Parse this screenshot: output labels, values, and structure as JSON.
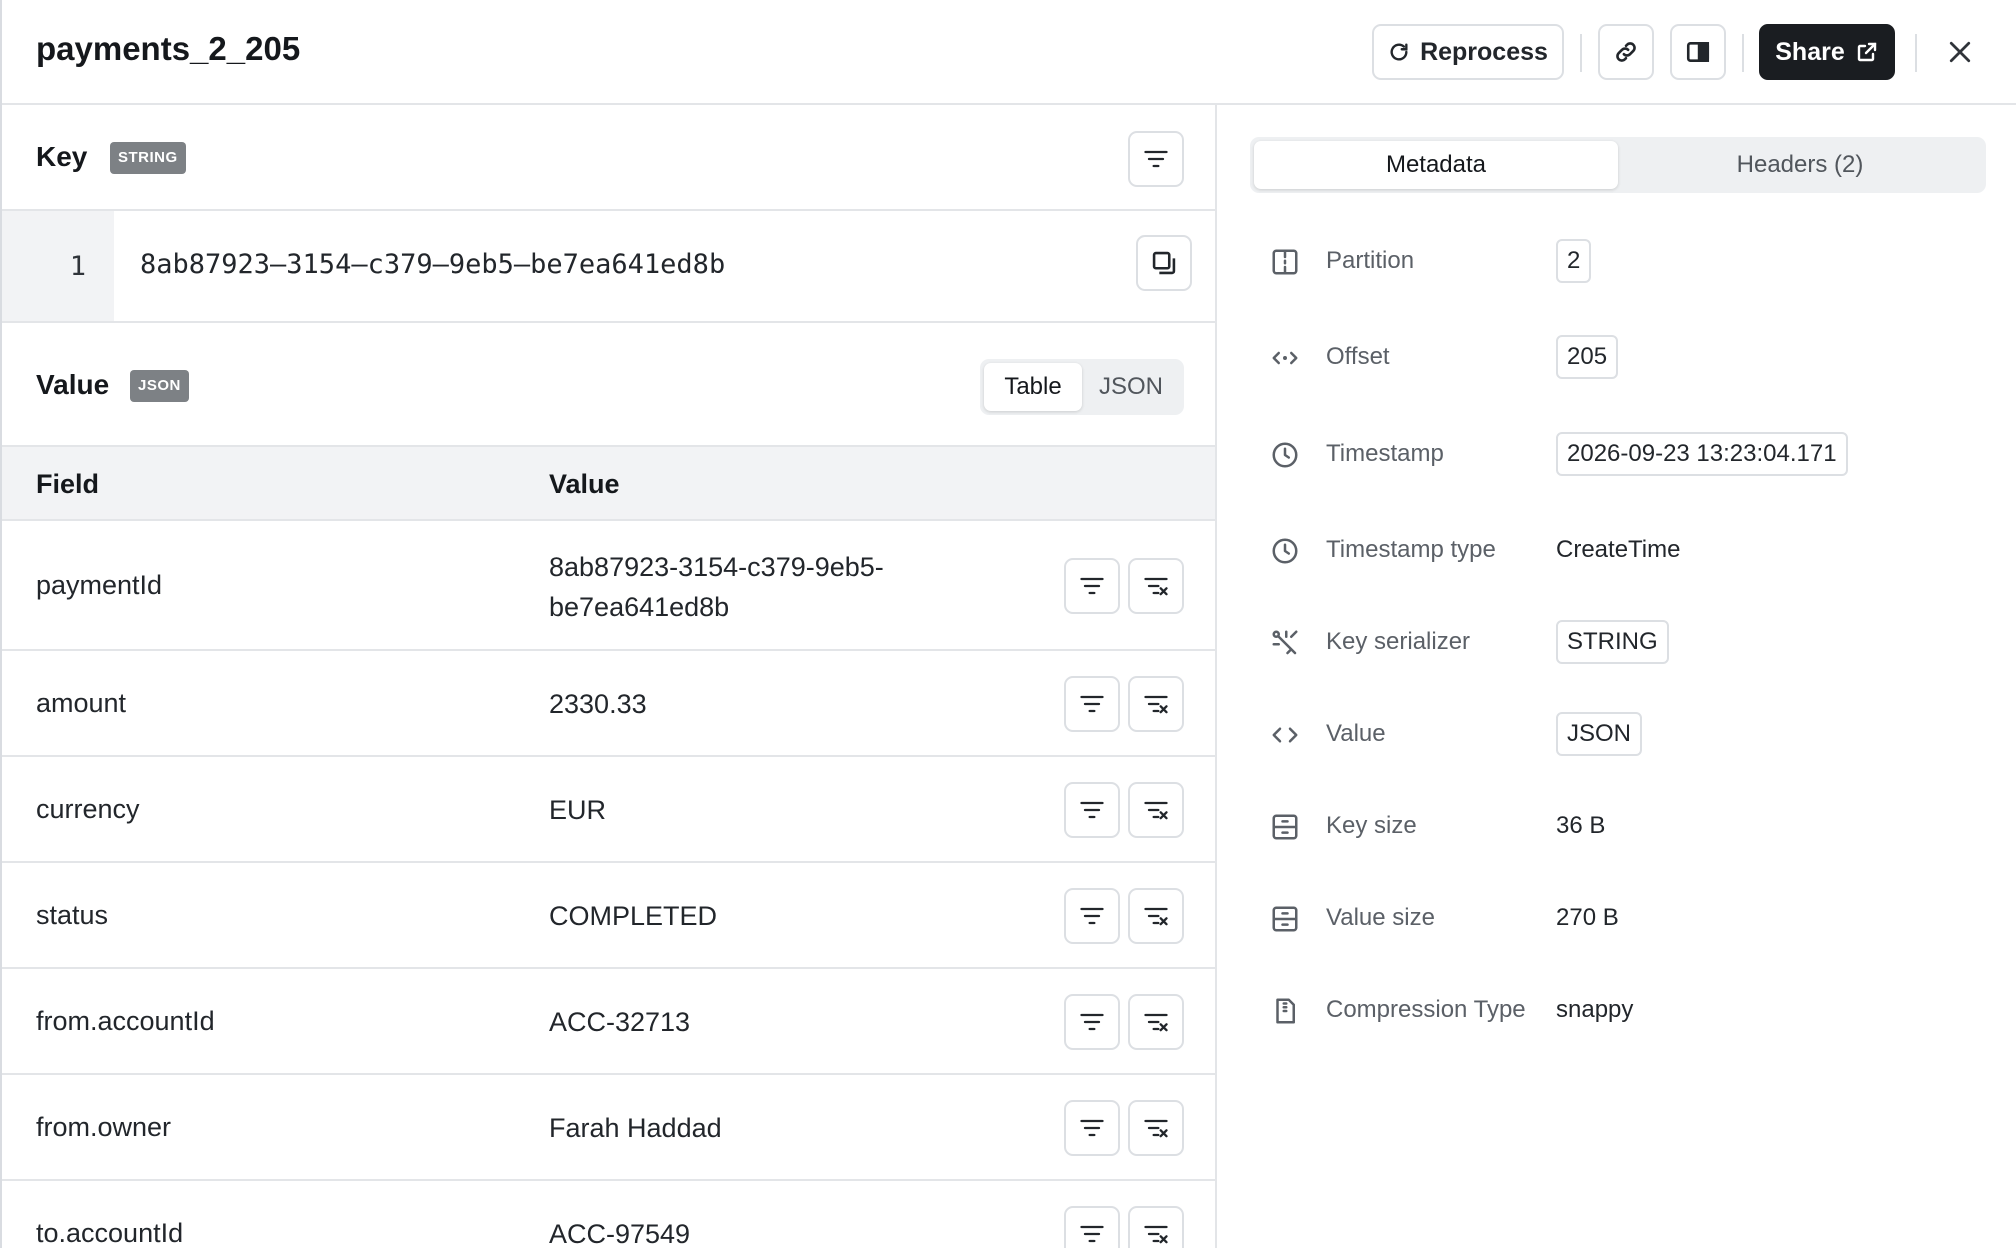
{
  "header": {
    "title": "payments_2_205",
    "reprocess_label": "Reprocess",
    "share_label": "Share"
  },
  "key": {
    "label": "Key",
    "type_badge": "STRING",
    "line_number": "1",
    "value": "8ab87923–3154–c379–9eb5–be7ea641ed8b"
  },
  "value": {
    "label": "Value",
    "type_badge": "JSON",
    "view_toggle": [
      "Table",
      "JSON"
    ],
    "active_view": "Table",
    "columns": [
      "Field",
      "Value"
    ],
    "rows": [
      {
        "field": "paymentId",
        "value": "8ab87923-3154-c379-9eb5-be7ea641ed8b"
      },
      {
        "field": "amount",
        "value": "2330.33"
      },
      {
        "field": "currency",
        "value": "EUR"
      },
      {
        "field": "status",
        "value": "COMPLETED"
      },
      {
        "field": "from.accountId",
        "value": "ACC-32713"
      },
      {
        "field": "from.owner",
        "value": "Farah Haddad"
      },
      {
        "field": "to.accountId",
        "value": "ACC-97549"
      }
    ]
  },
  "side": {
    "tabs": [
      "Metadata",
      "Headers (2)"
    ],
    "active_tab": "Metadata",
    "metadata": [
      {
        "icon": "partition-icon",
        "label": "Partition",
        "value": "2",
        "chip": true
      },
      {
        "icon": "offset-icon",
        "label": "Offset",
        "value": "205",
        "chip": true
      },
      {
        "icon": "clock-icon",
        "label": "Timestamp",
        "value": "2026-09-23 13:23:04.171",
        "chip": true
      },
      {
        "icon": "clock-icon",
        "label": "Timestamp type",
        "value": "CreateTime",
        "chip": false
      },
      {
        "icon": "key-serializer-icon",
        "label": "Key serializer",
        "value": "STRING",
        "chip": true
      },
      {
        "icon": "code-icon",
        "label": "Value",
        "value": "JSON",
        "chip": true
      },
      {
        "icon": "size-icon",
        "label": "Key size",
        "value": "36 B",
        "chip": false
      },
      {
        "icon": "size-icon",
        "label": "Value size",
        "value": "270 B",
        "chip": false
      },
      {
        "icon": "compression-icon",
        "label": "Compression Type",
        "value": "snappy",
        "chip": false
      }
    ]
  },
  "colors": {
    "accent_dark": "#1a1d21",
    "border": "#e3e5e8",
    "badge_bg": "#7d8185"
  }
}
